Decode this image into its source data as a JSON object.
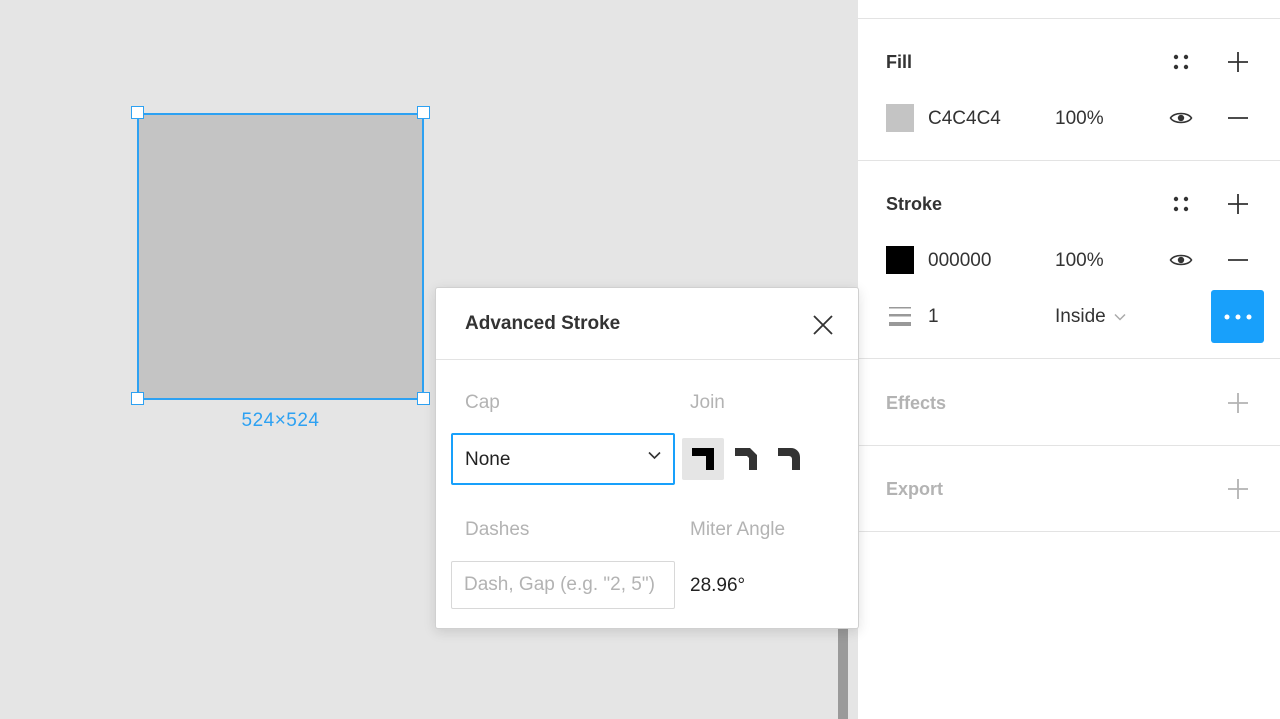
{
  "canvas": {
    "selection_size": "524×524"
  },
  "fill": {
    "title": "Fill",
    "color_hex": "C4C4C4",
    "swatch_color": "#c4c4c4",
    "opacity": "100%"
  },
  "stroke": {
    "title": "Stroke",
    "color_hex": "000000",
    "swatch_color": "#000000",
    "opacity": "100%",
    "weight": "1",
    "position": "Inside"
  },
  "effects": {
    "title": "Effects"
  },
  "export": {
    "title": "Export"
  },
  "advanced_stroke": {
    "title": "Advanced Stroke",
    "cap_label": "Cap",
    "cap_value": "None",
    "join_label": "Join",
    "join_options": [
      "miter-join-icon",
      "bevel-join-icon",
      "round-join-icon"
    ],
    "join_selected": "miter-join-icon",
    "dashes_label": "Dashes",
    "dashes_placeholder": "Dash, Gap (e.g. \"2, 5\")",
    "miter_angle_label": "Miter Angle",
    "miter_angle_value": "28.96°"
  },
  "colors": {
    "accent": "#18a0fb",
    "selection": "#2da1f2"
  }
}
